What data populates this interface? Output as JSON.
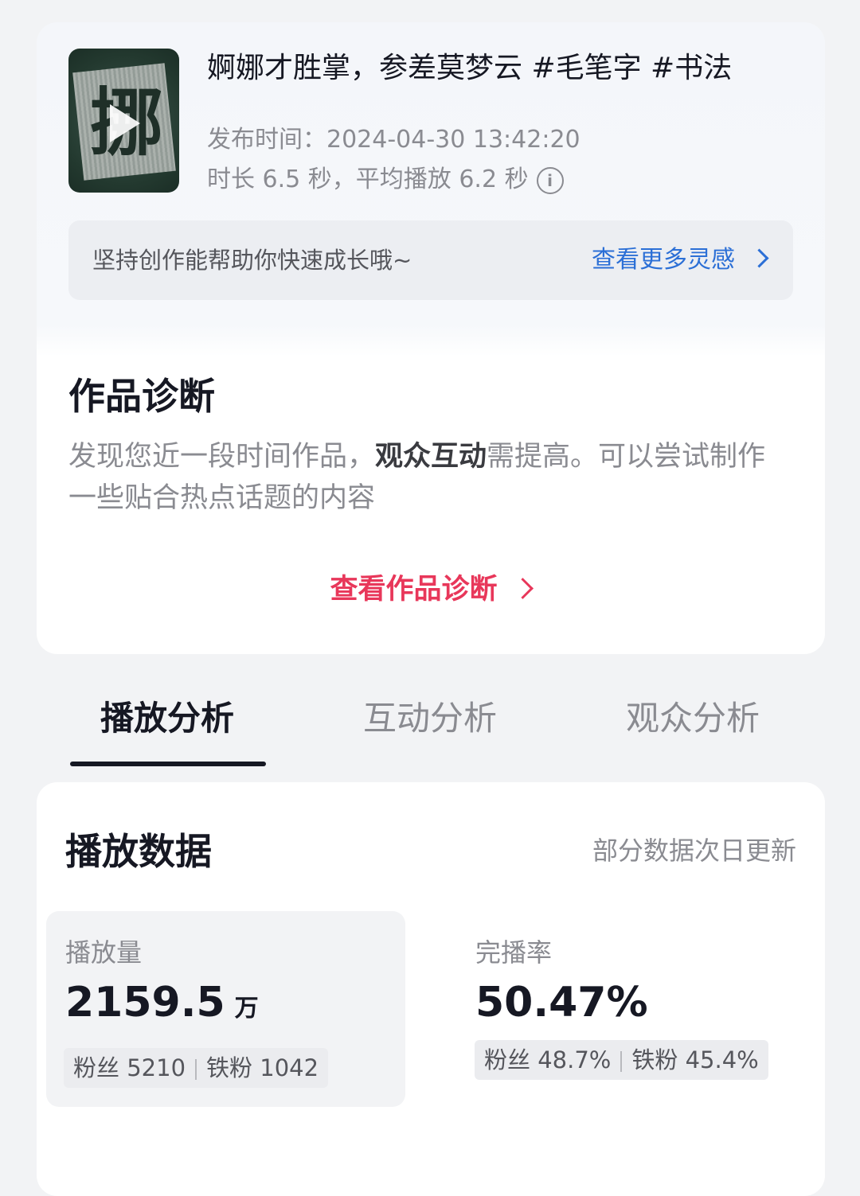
{
  "video": {
    "title": "婀娜才胜掌，参差莫梦云 #毛笔字 #书法",
    "thumbnail_glyph": "挪",
    "publish_time": "发布时间：2024-04-30 13:42:20",
    "duration": "时长 6.5 秒，平均播放 6.2 秒",
    "info_glyph": "i"
  },
  "tip": {
    "text": "坚持创作能帮助你快速成长哦~",
    "link": "查看更多灵感"
  },
  "diagnosis": {
    "title": "作品诊断",
    "desc_before": "发现您近一段时间作品，",
    "desc_bold": "观众互动",
    "desc_after": "需提高。可以尝试制作一些贴合热点话题的内容",
    "link": "查看作品诊断"
  },
  "tabs": [
    {
      "label": "播放分析",
      "active": true
    },
    {
      "label": "互动分析",
      "active": false
    },
    {
      "label": "观众分析",
      "active": false
    }
  ],
  "play_data": {
    "title": "播放数据",
    "note": "部分数据次日更新",
    "metrics": [
      {
        "label": "播放量",
        "value": "2159.5",
        "unit": "万",
        "fans": "粉丝 5210",
        "iron_fans": "铁粉 1042"
      },
      {
        "label": "完播率",
        "value": "50.47%",
        "unit": "",
        "fans": "粉丝 48.7%",
        "iron_fans": "铁粉 45.4%"
      }
    ]
  },
  "colors": {
    "accent_link": "#2b6fd6",
    "diagnosis_link": "#e8375a",
    "primary_text": "#161823",
    "secondary_text": "#8a8b91"
  }
}
